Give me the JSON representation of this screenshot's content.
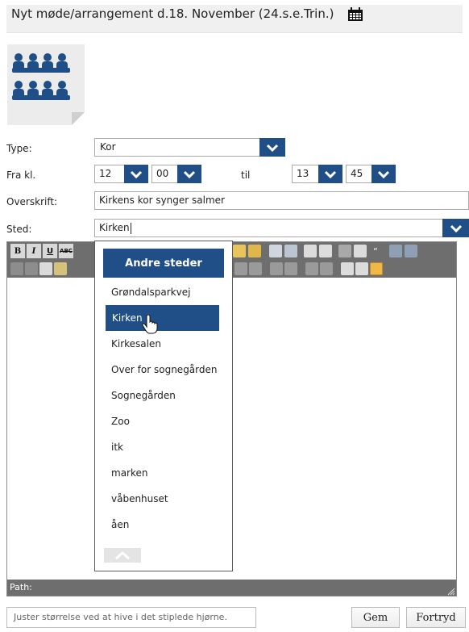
{
  "header": {
    "title": "Nyt møde/arrangement d.18. November (24.s.e.Trin.)",
    "calendar_icon": "calendar-icon"
  },
  "image": {
    "icon": "choir-icon"
  },
  "form": {
    "type_label": "Type:",
    "type_value": "Kor",
    "from_label": "Fra kl.",
    "from_hour": "12",
    "from_min": "00",
    "to_label": "til",
    "to_hour": "13",
    "to_min": "45",
    "headline_label": "Overskrift:",
    "headline_value": "Kirkens kor synger salmer",
    "place_label": "Sted:",
    "place_value": "Kirken"
  },
  "editor": {
    "path_label": "Path:"
  },
  "popup": {
    "header": "Andre steder",
    "items": [
      "Grøndalsparkvej",
      "Kirken",
      "Kirkesalen",
      "Over for sognegården",
      "Sognegården",
      "Zoo",
      "itk",
      "marken",
      "våbenhuset",
      "åen"
    ],
    "selected": "Kirken"
  },
  "footer": {
    "hint": "Juster størrelse ved at hive i det stiplede hjørne.",
    "save_label": "Gem",
    "cancel_label": "Fortryd"
  },
  "colors": {
    "accent": "#1f4f86",
    "toolbar": "#6e6e6e"
  }
}
